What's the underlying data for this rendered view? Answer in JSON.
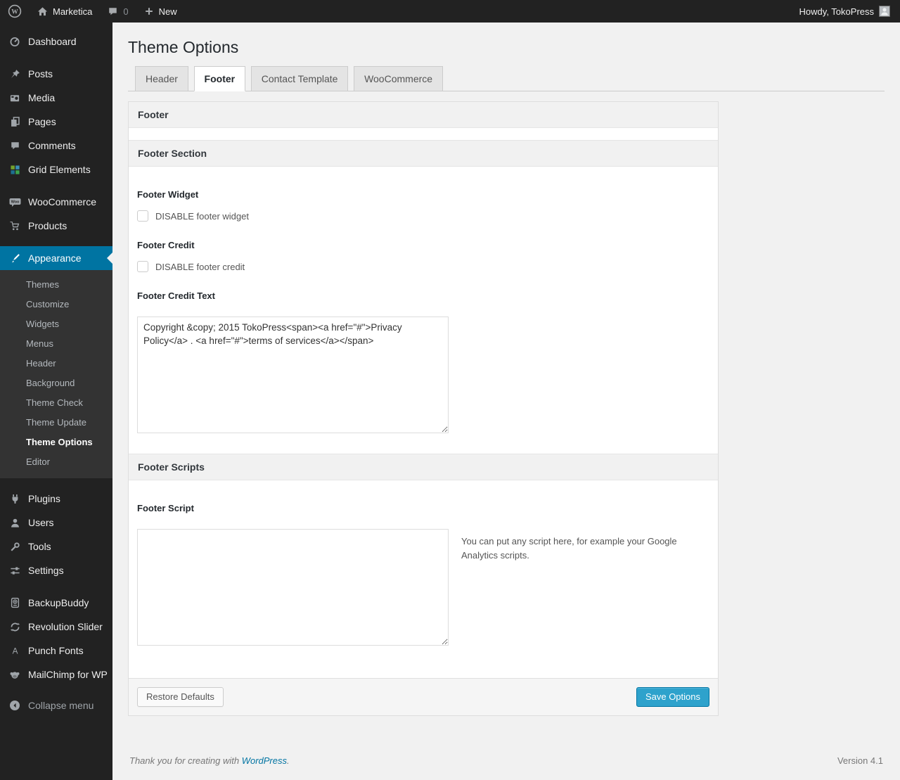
{
  "admin_bar": {
    "site_name": "Marketica",
    "comment_count": "0",
    "new_label": "New",
    "howdy": "Howdy, TokoPress"
  },
  "sidebar": {
    "items": [
      "Dashboard",
      "Posts",
      "Media",
      "Pages",
      "Comments",
      "Grid Elements",
      "WooCommerce",
      "Products",
      "Appearance",
      "Plugins",
      "Users",
      "Tools",
      "Settings",
      "BackupBuddy",
      "Revolution Slider",
      "Punch Fonts",
      "MailChimp for WP"
    ],
    "submenu": [
      "Themes",
      "Customize",
      "Widgets",
      "Menus",
      "Header",
      "Background",
      "Theme Check",
      "Theme Update",
      "Theme Options",
      "Editor"
    ],
    "collapse_label": "Collapse menu"
  },
  "page": {
    "title": "Theme Options",
    "tabs": [
      "Header",
      "Footer",
      "Contact Template",
      "WooCommerce"
    ]
  },
  "panel": {
    "box_title": "Footer",
    "section_title": "Footer Section",
    "footer_widget_label": "Footer Widget",
    "footer_widget_checkbox": "DISABLE footer widget",
    "footer_credit_label": "Footer Credit",
    "footer_credit_checkbox": "DISABLE footer credit",
    "footer_credit_text_label": "Footer Credit Text",
    "footer_credit_text_value": "Copyright &copy; 2015 TokoPress<span><a href=\"#\">Privacy Policy</a> . <a href=\"#\">terms of services</a></span>",
    "scripts_title": "Footer Scripts",
    "footer_script_label": "Footer Script",
    "footer_script_value": "",
    "footer_script_help": "You can put any script here, for example your Google Analytics scripts.",
    "restore_button": "Restore Defaults",
    "save_button": "Save Options"
  },
  "footer": {
    "thanks_text": "Thank you for creating with",
    "link_label": "WordPress",
    "period": ".",
    "version": "Version 4.1"
  },
  "colors": {
    "accent": "#0074a2",
    "primary_button": "#2ea2cc",
    "sidebar_bg": "#222222",
    "content_bg": "#f1f1f1"
  }
}
